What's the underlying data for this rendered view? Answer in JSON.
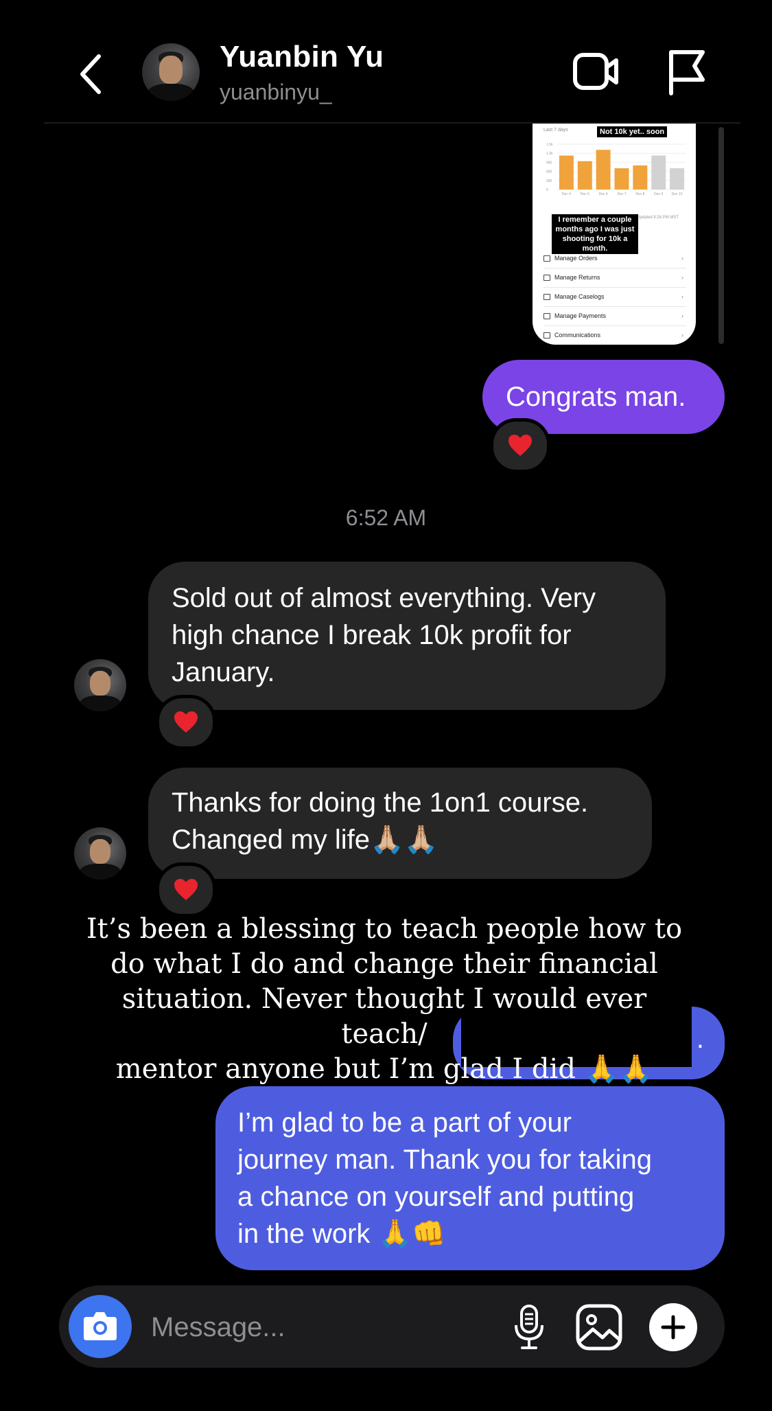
{
  "header": {
    "name": "Yuanbin Yu",
    "handle": "yuanbinyu_"
  },
  "shared_image": {
    "header_left": "Last 7 days",
    "sticker_top": "Not 10k yet.. soon",
    "sticker_mid": "I remember a couple months ago I was just shooting for 10k a month.",
    "updated_text": "Updated 9:28 PM MST",
    "y_ticks": [
      "1.5k",
      "1.2k",
      "900",
      "600",
      "300",
      "0"
    ],
    "chart_data": {
      "type": "bar",
      "categories": [
        "Dec 4",
        "Dec 5",
        "Dec 6",
        "Dec 7",
        "Dec 8",
        "Dec 9",
        "Dec 10"
      ],
      "values": [
        1200,
        1000,
        1400,
        750,
        850,
        1200,
        750
      ],
      "colors": [
        "#f0a23b",
        "#f0a23b",
        "#f0a23b",
        "#f0a23b",
        "#f0a23b",
        "#d2d2d2",
        "#d2d2d2"
      ],
      "ylim": [
        0,
        1600
      ]
    },
    "menu_items": [
      "Manage Orders",
      "Manage Returns",
      "Manage Caselogs",
      "Manage Payments",
      "Communications"
    ]
  },
  "messages": {
    "congrats": "Congrats man.",
    "timestamp": "6:52 AM",
    "sold_out": [
      "Sold out of almost everything. Very",
      "high chance I break 10k profit for",
      "January."
    ],
    "thanks": [
      "Thanks for doing the 1on1 course.",
      "Changed my life🙏🏼🙏🏼"
    ],
    "reply": [
      "I’m glad to be a part of your",
      "journey man. Thank you for taking",
      "a chance on yourself and putting",
      "in the work 🙏👊"
    ],
    "hidden_tail": "."
  },
  "overlay_caption": [
    "It’s been a blessing to teach people how to",
    "do what I do and change their financial",
    "situation. Never thought I would ever teach/",
    "mentor anyone but I’m glad I did 🙏🙏"
  ],
  "input": {
    "placeholder": "Message..."
  },
  "colors": {
    "purple_bubble": "#7a44e6",
    "blue_bubble": "#4e5de0",
    "gray_bubble": "#262626",
    "camera_button": "#3d74f0",
    "heart": "#e8242f"
  },
  "icons": [
    "back-arrow-icon",
    "video-call-icon",
    "flag-icon",
    "camera-icon",
    "microphone-icon",
    "gallery-icon",
    "plus-icon",
    "heart-icon"
  ]
}
